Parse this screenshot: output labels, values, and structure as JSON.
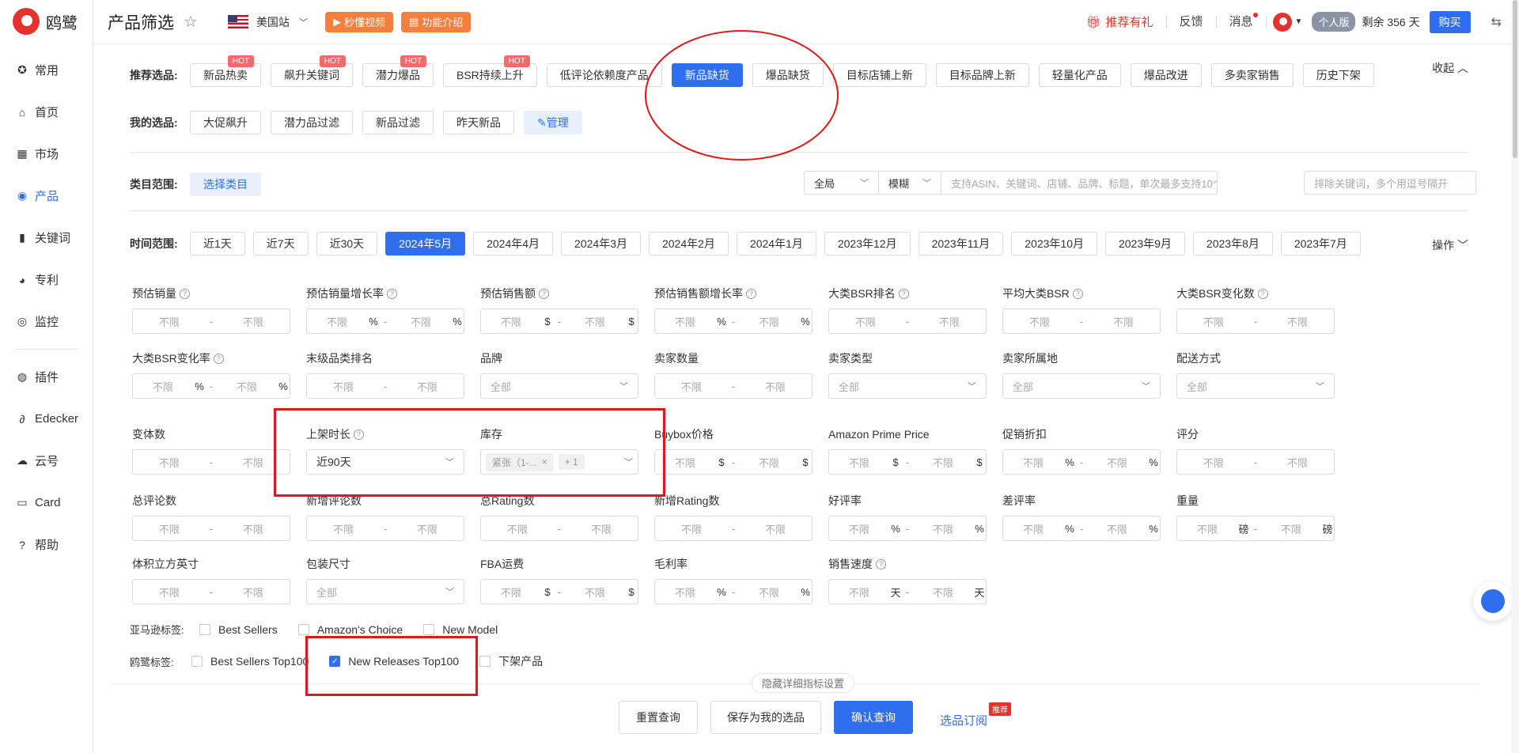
{
  "sidebar": {
    "logo_text": "鸥鹭",
    "items": [
      {
        "label": "常用",
        "icon": "star-icon"
      },
      {
        "label": "首页",
        "icon": "home-icon"
      },
      {
        "label": "市场",
        "icon": "grid-icon"
      },
      {
        "label": "产品",
        "icon": "eye-icon"
      },
      {
        "label": "关键词",
        "icon": "bar-chart-icon"
      },
      {
        "label": "专利",
        "icon": "patent-icon"
      },
      {
        "label": "监控",
        "icon": "monitor-icon"
      },
      {
        "label": "插件",
        "icon": "chrome-icon"
      },
      {
        "label": "Edecker",
        "icon": "edecker-icon"
      },
      {
        "label": "云号",
        "icon": "cloud-icon"
      },
      {
        "label": "Card",
        "icon": "card-icon"
      },
      {
        "label": "帮助",
        "icon": "help-icon"
      }
    ]
  },
  "header": {
    "title": "产品筛选",
    "site": "美国站",
    "video_btn": "秒懂视频",
    "intro_btn": "功能介绍",
    "gift": "推荐有礼",
    "feedback": "反馈",
    "message": "消息",
    "plan": "个人版",
    "remain": "剩余 356 天",
    "buy": "购买"
  },
  "recommend": {
    "label": "推荐选品:",
    "items": [
      {
        "label": "新品热卖",
        "hot": "HOT"
      },
      {
        "label": "飙升关键词",
        "hot": "HOT"
      },
      {
        "label": "潜力爆品",
        "hot": "HOT"
      },
      {
        "label": "BSR持续上升",
        "hot": "HOT"
      },
      {
        "label": "低评论依赖度产品",
        "hot": ""
      },
      {
        "label": "新品缺货",
        "hot": ""
      },
      {
        "label": "爆品缺货",
        "hot": ""
      },
      {
        "label": "目标店铺上新",
        "hot": ""
      },
      {
        "label": "目标品牌上新",
        "hot": ""
      },
      {
        "label": "轻量化产品",
        "hot": ""
      },
      {
        "label": "爆品改进",
        "hot": ""
      },
      {
        "label": "多卖家销售",
        "hot": ""
      },
      {
        "label": "历史下架",
        "hot": ""
      }
    ],
    "collapse": "收起"
  },
  "mine": {
    "label": "我的选品:",
    "items": [
      "大促飙升",
      "潜力品过滤",
      "新品过滤",
      "昨天新品"
    ],
    "manage": "管理"
  },
  "category": {
    "label": "类目范围:",
    "select": "选择类目",
    "scope": "全局",
    "match": "模糊",
    "search_placeholder": "支持ASIN、关键词、店铺、品牌、标题，单次最多支持10个查询，多",
    "exclude_placeholder": "排除关键词，多个用逗号隔开"
  },
  "time": {
    "label": "时间范围:",
    "items": [
      "近1天",
      "近7天",
      "近30天",
      "2024年5月",
      "2024年4月",
      "2024年3月",
      "2024年2月",
      "2024年1月",
      "2023年12月",
      "2023年11月",
      "2023年10月",
      "2023年9月",
      "2023年8月",
      "2023年7月"
    ],
    "operate": "操作"
  },
  "metrics": {
    "placeholder": "不限",
    "r1": [
      {
        "label": "预估销量",
        "u": ""
      },
      {
        "label": "预估销量增长率",
        "u": "%"
      },
      {
        "label": "预估销售额",
        "u": "$"
      },
      {
        "label": "预估销售额增长率",
        "u": "%"
      },
      {
        "label": "大类BSR排名",
        "u": ""
      },
      {
        "label": "平均大类BSR",
        "u": ""
      },
      {
        "label": "大类BSR变化数",
        "u": ""
      }
    ],
    "r2": [
      {
        "label": "大类BSR变化率",
        "u": "%"
      },
      {
        "label": "末级品类排名",
        "u": ""
      },
      {
        "label": "品牌",
        "select": "全部"
      },
      {
        "label": "卖家数量",
        "u": ""
      },
      {
        "label": "卖家类型",
        "select": "全部"
      },
      {
        "label": "卖家所属地",
        "select": "全部"
      },
      {
        "label": "配送方式",
        "select": "全部"
      }
    ],
    "r3": {
      "variants": "变体数",
      "listing_age": "上架时长",
      "listing_age_value": "近90天",
      "stock": "库存",
      "stock_tag": "紧张（1-...",
      "stock_more": "+ 1",
      "buybox": "Buybox价格",
      "prime": "Amazon Prime Price",
      "discount": "促销折扣",
      "rating": "评分"
    },
    "r4": [
      {
        "label": "总评论数",
        "u": ""
      },
      {
        "label": "新增评论数",
        "u": ""
      },
      {
        "label": "总Rating数",
        "u": ""
      },
      {
        "label": "新增Rating数",
        "u": ""
      },
      {
        "label": "好评率",
        "u": "%"
      },
      {
        "label": "差评率",
        "u": "%"
      },
      {
        "label": "重量",
        "u": "磅"
      }
    ],
    "r5": [
      {
        "label": "体积立方英寸",
        "u": ""
      },
      {
        "label": "包装尺寸",
        "select": "全部"
      },
      {
        "label": "FBA运费",
        "u": "$"
      },
      {
        "label": "毛利率",
        "u": "%"
      },
      {
        "label": "销售速度",
        "u": "天"
      }
    ]
  },
  "amazon_tags": {
    "label": "亚马逊标签:",
    "items": [
      "Best Sellers",
      "Amazon's Choice",
      "New Model"
    ]
  },
  "oulu_tags": {
    "label": "鸥鹭标签:",
    "items": [
      {
        "label": "Best Sellers Top100",
        "checked": false
      },
      {
        "label": "New Releases Top100",
        "checked": true
      },
      {
        "label": "下架产品",
        "checked": false
      }
    ]
  },
  "footer": {
    "hide_settings": "隐藏详细指标设置",
    "reset": "重置查询",
    "save": "保存为我的选品",
    "confirm": "确认查询",
    "subscribe": "选品订阅",
    "subscribe_badge": "推荐"
  },
  "colors": {
    "accent": "#2f6fed",
    "brand": "#e5322d",
    "orange": "#f5803e"
  }
}
